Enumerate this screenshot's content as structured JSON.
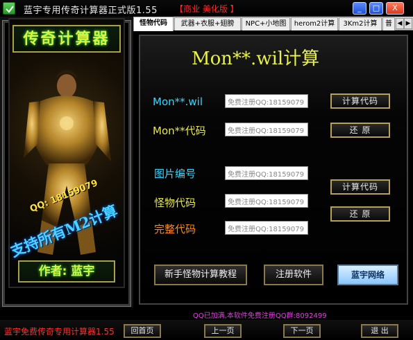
{
  "window": {
    "title": "蓝宇专用传奇计算器正式版1.55",
    "subtitle": "【商业 美化版 】",
    "min_label": "_",
    "max_label": "□",
    "close_label": "X"
  },
  "tabs": [
    {
      "label": "怪物代码",
      "active": true
    },
    {
      "label": "武器+衣服+翅膀",
      "active": false
    },
    {
      "label": "NPC+小地图",
      "active": false
    },
    {
      "label": "herom2计算",
      "active": false
    },
    {
      "label": "3Km2计算",
      "active": false
    },
    {
      "label": "普",
      "active": false
    }
  ],
  "tab_arrows": {
    "left": "◀",
    "right": "▶"
  },
  "left_panel": {
    "logo": "传奇计算器",
    "qq": "QQ: 18159079",
    "support": "支持所有M2计算",
    "author": "作者: 蓝宇"
  },
  "main": {
    "title": "Mon**.wil计算",
    "rows": [
      {
        "label": "Mon**.wil",
        "color": "cyan",
        "value": "免费注册QQ:18159079"
      },
      {
        "label": "Mon**代码",
        "color": "yellow",
        "value": "免费注册QQ:18159079"
      },
      {
        "label": "图片编号",
        "color": "cyan",
        "value": "免费注册QQ:18159079"
      },
      {
        "label": "怪物代码",
        "color": "yellow",
        "value": "免费注册QQ:18159079"
      },
      {
        "label": "完整代码",
        "color": "orange",
        "value": "免费注册QQ:18159079"
      }
    ],
    "buttons": {
      "calc1": "计算代码",
      "restore1": "还  原",
      "calc2": "计算代码",
      "restore2": "还  原",
      "tutorial": "新手怪物计算教程",
      "register": "注册软件",
      "brand": "蓝宇网络"
    }
  },
  "status": {
    "text": "QQ已加满,本软件免费注册QQ群:8092499"
  },
  "footer": {
    "title": "蓝宇免费传奇专用计算器1.55",
    "home": "回首页",
    "prev": "上一页",
    "next": "下一页",
    "exit": "退  出"
  }
}
